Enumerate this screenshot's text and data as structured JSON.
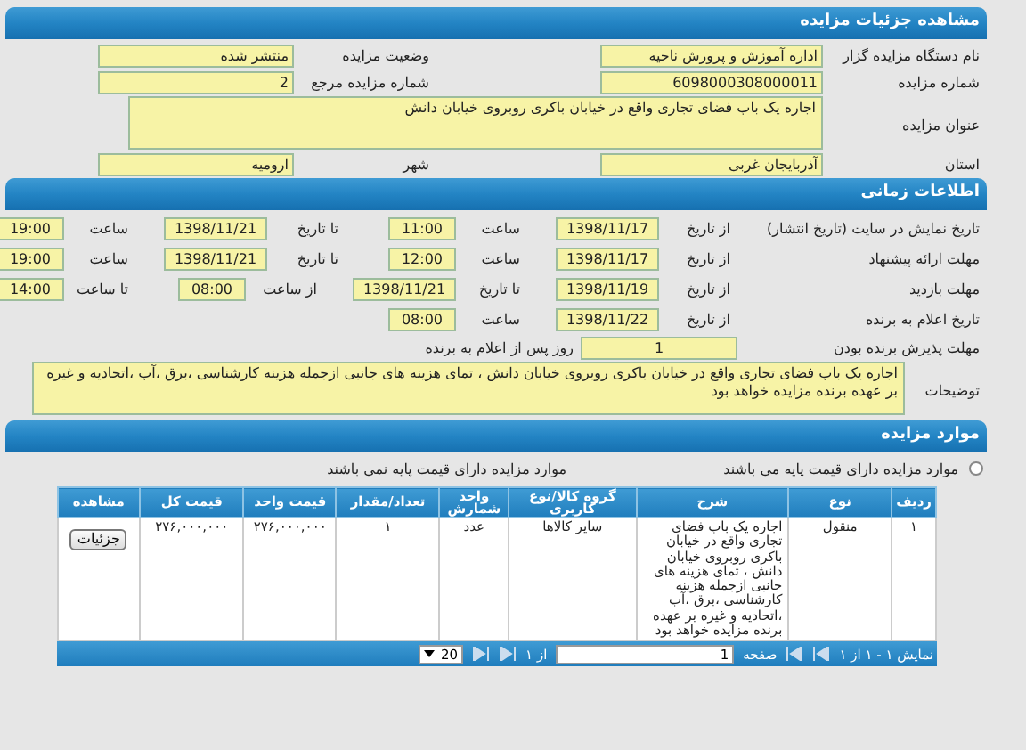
{
  "details": {
    "title": "مشاهده جزئیات مزایده",
    "rows": [
      {
        "kind": "pair",
        "fields": [
          {
            "label": "نام دستگاه مزایده گزار",
            "value": "اداره آموزش و پرورش ناحیه"
          },
          {
            "label": "وضعیت مزایده",
            "value": "منتشر شده"
          }
        ]
      },
      {
        "kind": "pair",
        "fields": [
          {
            "label": "شماره مزایده",
            "value": "6098000308000011"
          },
          {
            "label": "شماره مزایده مرجع",
            "value": "2"
          }
        ]
      },
      {
        "kind": "wide",
        "fields": [
          {
            "label": "عنوان مزایده",
            "value": "اجاره یک باب فضای تجاری واقع در خیابان باکری روبروی خیابان دانش"
          }
        ]
      },
      {
        "kind": "pair",
        "fields": [
          {
            "label": "استان",
            "value": "آذربایجان غربی"
          },
          {
            "label": "شهر",
            "value": "ارومیه"
          }
        ]
      }
    ]
  },
  "timing": {
    "title": "اطلاعات زمانی",
    "rows": [
      {
        "label": "تاریخ نمایش در سایت (تاریخ انتشار)",
        "parts": [
          {
            "label": "از تاریخ",
            "value": "1398/11/17"
          },
          {
            "label": "ساعت",
            "value": "11:00"
          },
          {
            "label": "تا تاریخ",
            "value": "1398/11/21"
          },
          {
            "label": "ساعت",
            "value": "19:00"
          }
        ]
      },
      {
        "label": "مهلت ارائه پیشنهاد",
        "parts": [
          {
            "label": "از تاریخ",
            "value": "1398/11/17"
          },
          {
            "label": "ساعت",
            "value": "12:00"
          },
          {
            "label": "تا تاریخ",
            "value": "1398/11/21"
          },
          {
            "label": "ساعت",
            "value": "19:00"
          }
        ]
      },
      {
        "label": "مهلت بازدید",
        "parts": [
          {
            "label": "از تاریخ",
            "value": "1398/11/19"
          },
          {
            "label": "تا تاریخ",
            "value": "1398/11/21"
          },
          {
            "label": "از ساعت",
            "value": "08:00"
          },
          {
            "label": "تا ساعت",
            "value": "14:00"
          }
        ]
      },
      {
        "label": "تاریخ اعلام به برنده",
        "parts": [
          {
            "label": "از تاریخ",
            "value": "1398/11/22"
          },
          {
            "label": "ساعت",
            "value": "08:00"
          }
        ]
      }
    ],
    "acceptance": {
      "label": "مهلت پذیرش برنده بودن",
      "value": "1",
      "suffix": "روز پس از اعلام به برنده"
    },
    "description": {
      "label": "توضیحات",
      "value": "اجاره یک باب فضای تجاری واقع در خیابان باکری روبروی خیابان دانش ، تمای هزینه های جانبی ازجمله هزینه کارشناسی ،برق ،آب ،اتحادیه و غیره بر عهده برنده مزایده خواهد بود"
    }
  },
  "items": {
    "title": "موارد مزایده",
    "options": [
      {
        "label": "موارد مزایده دارای قیمت پایه می باشند",
        "selected": false
      },
      {
        "label": "موارد مزایده دارای قیمت پایه نمی باشند"
      }
    ],
    "columns": [
      "ردیف",
      "نوع",
      "شرح",
      "گروه کالا/نوع کاربری",
      "واحد شمارش",
      "تعداد/مقدار",
      "قیمت واحد",
      "قیمت کل",
      "مشاهده"
    ],
    "rows": [
      {
        "cells": [
          "۱",
          "منقول",
          "اجاره یک باب فضای تجاری واقع در خیابان باکری روبروی خیابان دانش ، تمای هزینه های جانبی ازجمله هزینه  کارشناسی ،برق ،آب ،اتحادیه و غیره بر عهده برنده مزایده خواهد بود",
          "سایر کالاها",
          "عدد",
          "۱",
          "۲۷۶,۰۰۰,۰۰۰",
          "۲۷۶,۰۰۰,۰۰۰"
        ],
        "action": "جزئیات"
      }
    ],
    "footer": {
      "summary": "نمایش ۱ - ۱ از ۱",
      "page_label": "صفحه",
      "page": "1",
      "page_count": "از ۱",
      "page_size": "20"
    }
  }
}
